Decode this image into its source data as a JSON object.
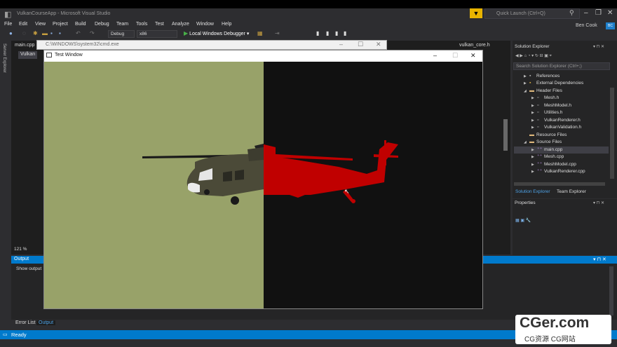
{
  "window": {
    "app_title": "VulkanCourseApp - Microsoft Visual Studio",
    "quick_launch": "Quick Launch (Ctrl+Q)",
    "user": "Ben Cook",
    "avatar": "BC"
  },
  "menu": [
    "File",
    "Edit",
    "View",
    "Project",
    "Build",
    "Debug",
    "Team",
    "Tools",
    "Test",
    "Analyze",
    "Window",
    "Help"
  ],
  "toolbar": {
    "config": "Debug",
    "platform": "x86",
    "debugger": "Local Windows Debugger"
  },
  "left_strip": {
    "label": "Server Explorer"
  },
  "editor": {
    "tab_main": "main.cpp",
    "tab_vulkan": "Vulkan",
    "tab_core": "vulkan_core.h",
    "zoom": "121 %"
  },
  "cmd_window": {
    "title": "C:\\WINDOWS\\system32\\cmd.exe"
  },
  "test_window": {
    "title": "Test Window"
  },
  "solution_explorer": {
    "title": "Solution Explorer",
    "search": "Search Solution Explorer (Ctrl+;)",
    "items": [
      {
        "label": "References",
        "level": 1
      },
      {
        "label": "External Dependencies",
        "level": 1
      },
      {
        "label": "Header Files",
        "level": 1
      },
      {
        "label": "Mesh.h",
        "level": 2
      },
      {
        "label": "MeshModel.h",
        "level": 2
      },
      {
        "label": "Utilities.h",
        "level": 2
      },
      {
        "label": "VulkanRenderer.h",
        "level": 2
      },
      {
        "label": "VulkanValidation.h",
        "level": 2
      },
      {
        "label": "Resource Files",
        "level": 1
      },
      {
        "label": "Source Files",
        "level": 1
      },
      {
        "label": "main.cpp",
        "level": 2,
        "selected": true
      },
      {
        "label": "Mesh.cpp",
        "level": 2
      },
      {
        "label": "MeshModel.cpp",
        "level": 2
      },
      {
        "label": "VulkanRenderer.cpp",
        "level": 2
      }
    ],
    "tab_solution": "Solution Explorer",
    "tab_team": "Team Explorer"
  },
  "properties": {
    "title": "Properties"
  },
  "output": {
    "title": "Output",
    "show_output": "Show output",
    "tab_error": "Error List",
    "tab_output": "Output"
  },
  "status": {
    "text": "Ready"
  },
  "watermark": {
    "big": "CGer.com",
    "small": "CG资源 CG网站"
  },
  "colors": {
    "accent": "#007acc",
    "scene_green": "#98a269",
    "scene_dark": "#111111",
    "heli_red": "#c00000"
  }
}
